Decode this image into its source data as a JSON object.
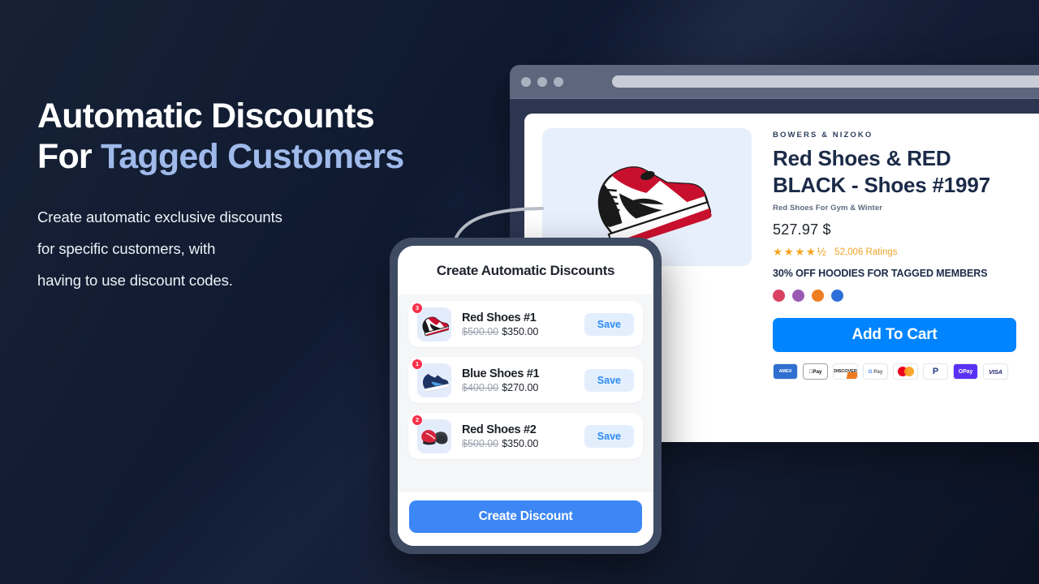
{
  "hero": {
    "headline_line1": "Automatic Discounts",
    "headline_line2_plain": "For ",
    "headline_line2_accent": "Tagged Customers",
    "subcopy_line1": "Create automatic exclusive discounts",
    "subcopy_line2": "for specific customers, with",
    "subcopy_line3": "having to use discount codes.",
    "accent_color": "#9fb9ea",
    "background_color": "#0f1a2e"
  },
  "browser": {
    "traffic_lights": [
      "close-dot",
      "minimize-dot",
      "maximize-dot"
    ],
    "address_bar_value": ""
  },
  "product": {
    "vendor": "BOWERS & NIZOKO",
    "title": "Red Shoes & RED BLACK - Shoes #1997",
    "subtitle": "Red Shoes For Gym & Winter",
    "price": "527.97 $",
    "stars": "★★★★½",
    "rating_count": "52,006 Ratings",
    "promo": "30% OFF HOODIES FOR TAGGED MEMBERS",
    "add_to_cart_label": "Add To Cart",
    "accent_color": "#0084ff",
    "star_color": "#f5a623",
    "swatches": [
      {
        "name": "swatch-crimson",
        "color": "#d94263"
      },
      {
        "name": "swatch-purple",
        "color": "#9b59b6"
      },
      {
        "name": "swatch-orange",
        "color": "#ef7d22"
      },
      {
        "name": "swatch-blue",
        "color": "#2c6fd8"
      }
    ],
    "payments": [
      {
        "name": "amex",
        "label": "AMEX"
      },
      {
        "name": "apple-pay",
        "label": "␣Pay"
      },
      {
        "name": "discover",
        "label": "DISCOVER"
      },
      {
        "name": "google-pay",
        "label": "Pay"
      },
      {
        "name": "mastercard",
        "label": ""
      },
      {
        "name": "paypal",
        "label": "P"
      },
      {
        "name": "shop-pay",
        "label": "OPay"
      },
      {
        "name": "visa",
        "label": "VISA"
      }
    ]
  },
  "phone": {
    "title": "Create Automatic Discounts",
    "cta_label": "Create Discount",
    "cta_color": "#3c87f5",
    "save_label": "Save",
    "items": [
      {
        "badge": "3",
        "name": "Red Shoes #1",
        "old_price": "$500.00",
        "new_price": "$350.00",
        "image": "red-high-top-sneaker"
      },
      {
        "badge": "1",
        "name": "Blue Shoes #1",
        "old_price": "$400.00",
        "new_price": "$270.00",
        "image": "blue-high-top-sneaker"
      },
      {
        "badge": "2",
        "name": "Red Shoes #2",
        "old_price": "$500.00",
        "new_price": "$350.00",
        "image": "red-running-shoes-pair"
      }
    ]
  }
}
